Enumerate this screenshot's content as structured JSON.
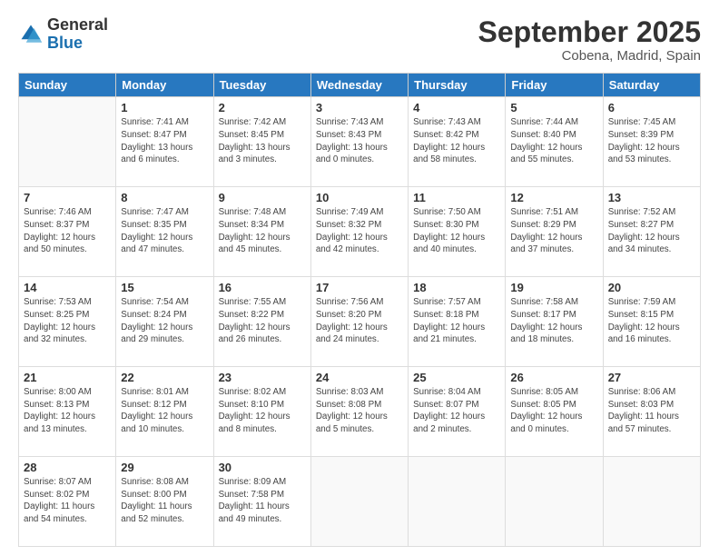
{
  "logo": {
    "general": "General",
    "blue": "Blue"
  },
  "title": "September 2025",
  "subtitle": "Cobena, Madrid, Spain",
  "days_header": [
    "Sunday",
    "Monday",
    "Tuesday",
    "Wednesday",
    "Thursday",
    "Friday",
    "Saturday"
  ],
  "weeks": [
    [
      {
        "day": "",
        "info": ""
      },
      {
        "day": "1",
        "info": "Sunrise: 7:41 AM\nSunset: 8:47 PM\nDaylight: 13 hours\nand 6 minutes."
      },
      {
        "day": "2",
        "info": "Sunrise: 7:42 AM\nSunset: 8:45 PM\nDaylight: 13 hours\nand 3 minutes."
      },
      {
        "day": "3",
        "info": "Sunrise: 7:43 AM\nSunset: 8:43 PM\nDaylight: 13 hours\nand 0 minutes."
      },
      {
        "day": "4",
        "info": "Sunrise: 7:43 AM\nSunset: 8:42 PM\nDaylight: 12 hours\nand 58 minutes."
      },
      {
        "day": "5",
        "info": "Sunrise: 7:44 AM\nSunset: 8:40 PM\nDaylight: 12 hours\nand 55 minutes."
      },
      {
        "day": "6",
        "info": "Sunrise: 7:45 AM\nSunset: 8:39 PM\nDaylight: 12 hours\nand 53 minutes."
      }
    ],
    [
      {
        "day": "7",
        "info": "Sunrise: 7:46 AM\nSunset: 8:37 PM\nDaylight: 12 hours\nand 50 minutes."
      },
      {
        "day": "8",
        "info": "Sunrise: 7:47 AM\nSunset: 8:35 PM\nDaylight: 12 hours\nand 47 minutes."
      },
      {
        "day": "9",
        "info": "Sunrise: 7:48 AM\nSunset: 8:34 PM\nDaylight: 12 hours\nand 45 minutes."
      },
      {
        "day": "10",
        "info": "Sunrise: 7:49 AM\nSunset: 8:32 PM\nDaylight: 12 hours\nand 42 minutes."
      },
      {
        "day": "11",
        "info": "Sunrise: 7:50 AM\nSunset: 8:30 PM\nDaylight: 12 hours\nand 40 minutes."
      },
      {
        "day": "12",
        "info": "Sunrise: 7:51 AM\nSunset: 8:29 PM\nDaylight: 12 hours\nand 37 minutes."
      },
      {
        "day": "13",
        "info": "Sunrise: 7:52 AM\nSunset: 8:27 PM\nDaylight: 12 hours\nand 34 minutes."
      }
    ],
    [
      {
        "day": "14",
        "info": "Sunrise: 7:53 AM\nSunset: 8:25 PM\nDaylight: 12 hours\nand 32 minutes."
      },
      {
        "day": "15",
        "info": "Sunrise: 7:54 AM\nSunset: 8:24 PM\nDaylight: 12 hours\nand 29 minutes."
      },
      {
        "day": "16",
        "info": "Sunrise: 7:55 AM\nSunset: 8:22 PM\nDaylight: 12 hours\nand 26 minutes."
      },
      {
        "day": "17",
        "info": "Sunrise: 7:56 AM\nSunset: 8:20 PM\nDaylight: 12 hours\nand 24 minutes."
      },
      {
        "day": "18",
        "info": "Sunrise: 7:57 AM\nSunset: 8:18 PM\nDaylight: 12 hours\nand 21 minutes."
      },
      {
        "day": "19",
        "info": "Sunrise: 7:58 AM\nSunset: 8:17 PM\nDaylight: 12 hours\nand 18 minutes."
      },
      {
        "day": "20",
        "info": "Sunrise: 7:59 AM\nSunset: 8:15 PM\nDaylight: 12 hours\nand 16 minutes."
      }
    ],
    [
      {
        "day": "21",
        "info": "Sunrise: 8:00 AM\nSunset: 8:13 PM\nDaylight: 12 hours\nand 13 minutes."
      },
      {
        "day": "22",
        "info": "Sunrise: 8:01 AM\nSunset: 8:12 PM\nDaylight: 12 hours\nand 10 minutes."
      },
      {
        "day": "23",
        "info": "Sunrise: 8:02 AM\nSunset: 8:10 PM\nDaylight: 12 hours\nand 8 minutes."
      },
      {
        "day": "24",
        "info": "Sunrise: 8:03 AM\nSunset: 8:08 PM\nDaylight: 12 hours\nand 5 minutes."
      },
      {
        "day": "25",
        "info": "Sunrise: 8:04 AM\nSunset: 8:07 PM\nDaylight: 12 hours\nand 2 minutes."
      },
      {
        "day": "26",
        "info": "Sunrise: 8:05 AM\nSunset: 8:05 PM\nDaylight: 12 hours\nand 0 minutes."
      },
      {
        "day": "27",
        "info": "Sunrise: 8:06 AM\nSunset: 8:03 PM\nDaylight: 11 hours\nand 57 minutes."
      }
    ],
    [
      {
        "day": "28",
        "info": "Sunrise: 8:07 AM\nSunset: 8:02 PM\nDaylight: 11 hours\nand 54 minutes."
      },
      {
        "day": "29",
        "info": "Sunrise: 8:08 AM\nSunset: 8:00 PM\nDaylight: 11 hours\nand 52 minutes."
      },
      {
        "day": "30",
        "info": "Sunrise: 8:09 AM\nSunset: 7:58 PM\nDaylight: 11 hours\nand 49 minutes."
      },
      {
        "day": "",
        "info": ""
      },
      {
        "day": "",
        "info": ""
      },
      {
        "day": "",
        "info": ""
      },
      {
        "day": "",
        "info": ""
      }
    ]
  ]
}
